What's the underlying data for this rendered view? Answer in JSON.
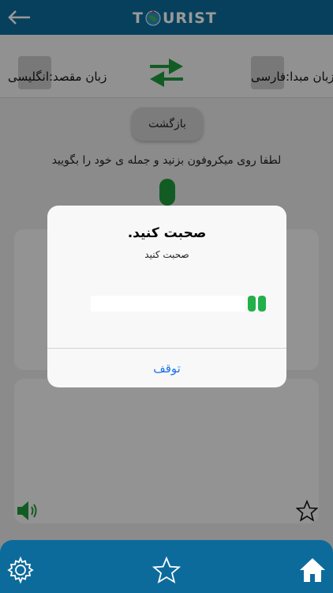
{
  "header": {
    "logo_left": "T",
    "logo_right": "URIST",
    "back_icon": "arrow-left-icon",
    "color": "#0d6b9c"
  },
  "languages": {
    "source_label": "زبان مبدا:فارسی",
    "target_label": "زبان مقصد:انگلیسی",
    "swap_icon": "swap-arrows-icon",
    "swap_color": "#1e9a3c"
  },
  "content": {
    "back_button": "بازگشت",
    "instruction": "لطفا روی میکروفون بزنید و جمله ی خود را بگویید",
    "mic_icon": "microphone-icon",
    "speaker_icon": "speaker-icon",
    "favorite_icon": "star-icon"
  },
  "dialog": {
    "title": "صحبت کنید.",
    "subtitle": "صحبت کنید",
    "stop_button": "توقف",
    "level_icon": "audio-level-icon"
  },
  "bottom_nav": {
    "settings_icon": "gear-icon",
    "favorites_icon": "star-icon",
    "home_icon": "home-icon"
  }
}
